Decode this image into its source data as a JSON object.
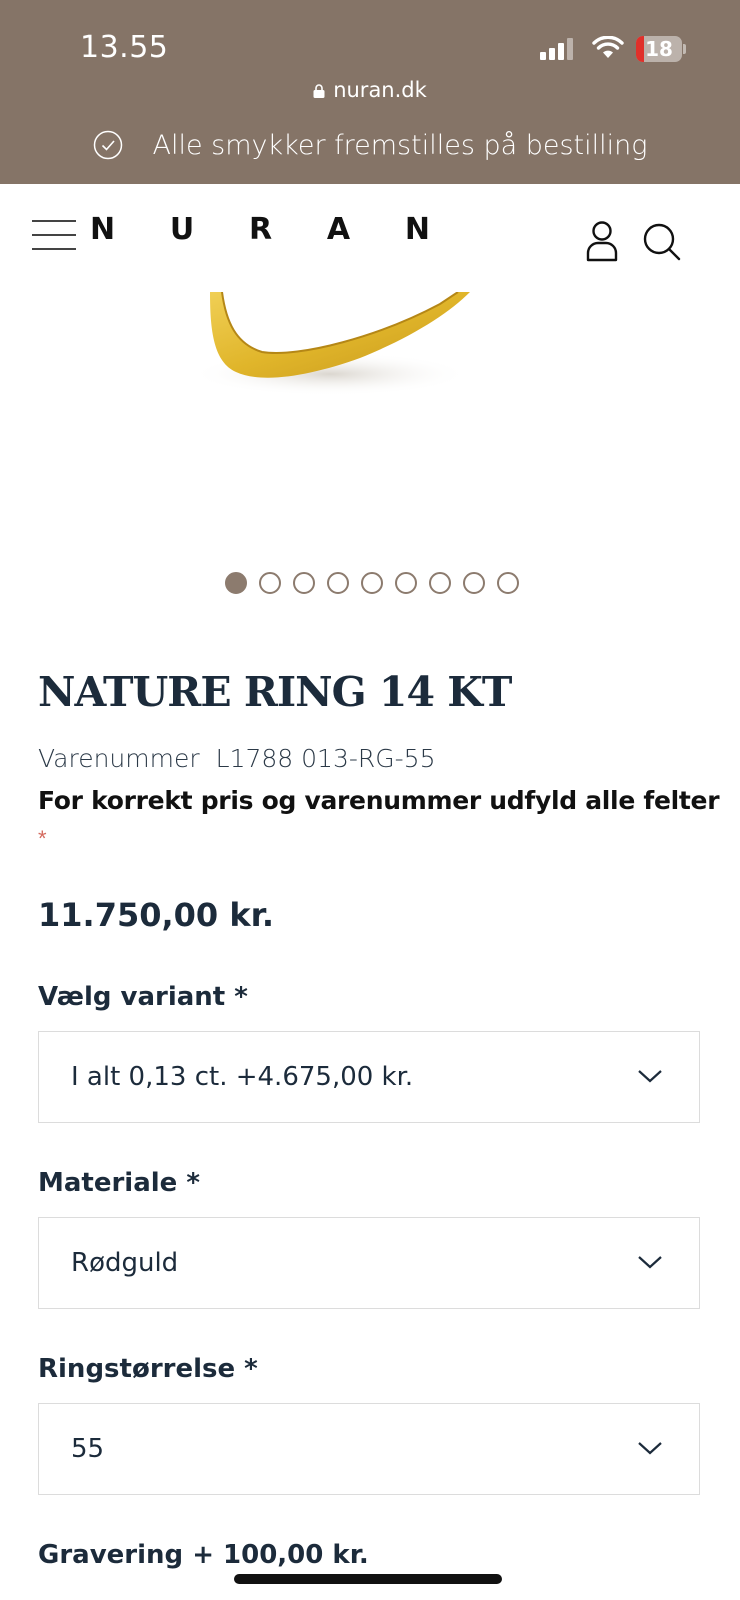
{
  "status_bar": {
    "time": "13.55",
    "battery": "18",
    "battery_fraction": 0.18
  },
  "browser": {
    "url": "nuran.dk"
  },
  "promo": {
    "text": "Alle smykker fremstilles på bestilling"
  },
  "header": {
    "logo_letters": [
      "N",
      "U",
      "R",
      "A",
      "N"
    ]
  },
  "gallery": {
    "image_count": 9,
    "active_index": 0
  },
  "product": {
    "title": "NATURE RING 14 KT",
    "sku_label": "Varenummer",
    "sku": "L1788 013-RG-55",
    "notice": "For korrekt pris og varenummer udfyld alle felter",
    "required_mark": "*",
    "price": "11.750,00 kr."
  },
  "options": [
    {
      "label": "Vælg variant *",
      "value": "I alt 0,13 ct. +4.675,00 kr."
    },
    {
      "label": "Materiale *",
      "value": "Rødguld"
    },
    {
      "label": "Ringstørrelse *",
      "value": "55"
    }
  ],
  "engraving": {
    "label": "Gravering + 100,00 kr."
  },
  "colors": {
    "brand_bar": "#857467",
    "dot": "#8c7b6e",
    "text": "#1c2b3b",
    "gold": "#e2b82b"
  }
}
